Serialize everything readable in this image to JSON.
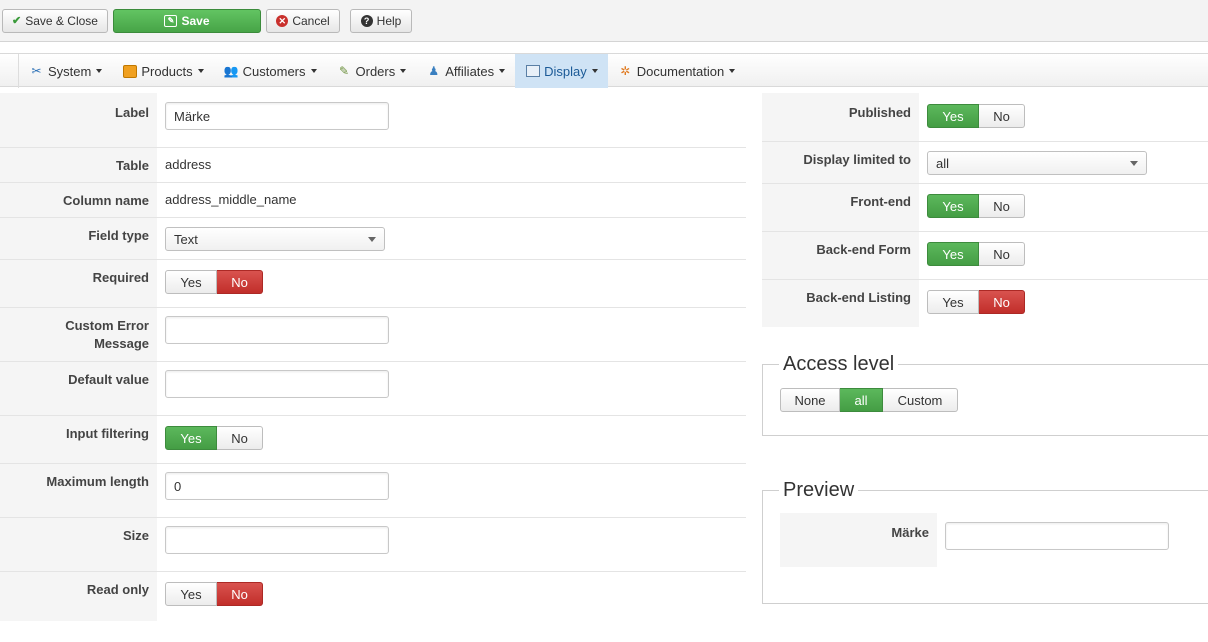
{
  "toolbar": {
    "save_close": "Save & Close",
    "save": "Save",
    "cancel": "Cancel",
    "help": "Help"
  },
  "menu": {
    "system": "System",
    "products": "Products",
    "customers": "Customers",
    "orders": "Orders",
    "affiliates": "Affiliates",
    "display": "Display",
    "documentation": "Documentation"
  },
  "left": {
    "label_label": "Label",
    "label_value": "Märke",
    "table_label": "Table",
    "table_value": "address",
    "column_label": "Column name",
    "column_value": "address_middle_name",
    "fieldtype_label": "Field type",
    "fieldtype_value": "Text",
    "required_label": "Required",
    "custom_error_label_1": "Custom Error",
    "custom_error_label_2": "Message",
    "default_label": "Default value",
    "input_filtering_label": "Input filtering",
    "max_length_label": "Maximum length",
    "max_length_value": "0",
    "size_label": "Size",
    "readonly_label": "Read only"
  },
  "right": {
    "published_label": "Published",
    "display_limited_label": "Display limited to",
    "display_limited_value": "all",
    "frontend_label": "Front-end",
    "backend_form_label": "Back-end Form",
    "backend_listing_label": "Back-end Listing"
  },
  "access": {
    "legend": "Access level",
    "none": "None",
    "all": "all",
    "custom": "Custom"
  },
  "preview": {
    "legend": "Preview",
    "field_label": "Märke"
  },
  "toggles": {
    "yes": "Yes",
    "no": "No"
  },
  "colors": {
    "green": "#47a447",
    "red": "#c12e2a",
    "active_menu": "#cfe3f5"
  }
}
